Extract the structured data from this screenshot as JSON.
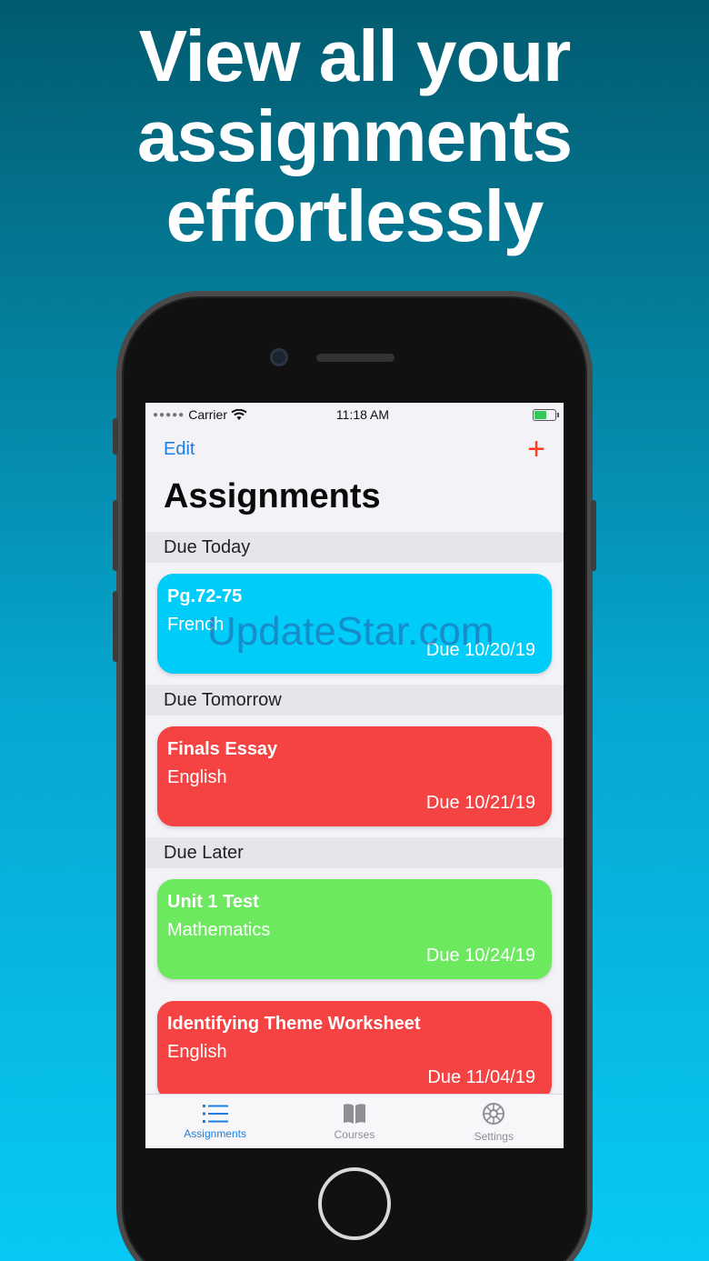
{
  "headline": [
    "View all your",
    "assignments",
    "effortlessly"
  ],
  "status_bar": {
    "carrier": "Carrier",
    "time": "11:18 AM"
  },
  "nav": {
    "edit_label": "Edit",
    "add_label": "+"
  },
  "page_title": "Assignments",
  "sections": [
    {
      "header": "Due Today",
      "cards": [
        {
          "title": "Pg.72-75",
          "course": "French",
          "due": "Due 10/20/19",
          "color": "#00ccfa"
        }
      ]
    },
    {
      "header": "Due Tomorrow",
      "cards": [
        {
          "title": "Finals Essay",
          "course": "English",
          "due": "Due 10/21/19",
          "color": "#f54242"
        }
      ]
    },
    {
      "header": "Due Later",
      "cards": [
        {
          "title": "Unit 1 Test",
          "course": "Mathematics",
          "due": "Due 10/24/19",
          "color": "#6ce95f"
        },
        {
          "title": "Identifying Theme Worksheet",
          "course": "English",
          "due": "Due 11/04/19",
          "color": "#f54242"
        }
      ]
    }
  ],
  "tabs": [
    {
      "label": "Assignments",
      "icon": "list-icon",
      "active": true
    },
    {
      "label": "Courses",
      "icon": "book-icon",
      "active": false
    },
    {
      "label": "Settings",
      "icon": "gear-icon",
      "active": false
    }
  ],
  "watermark": "UpdateStar.com"
}
